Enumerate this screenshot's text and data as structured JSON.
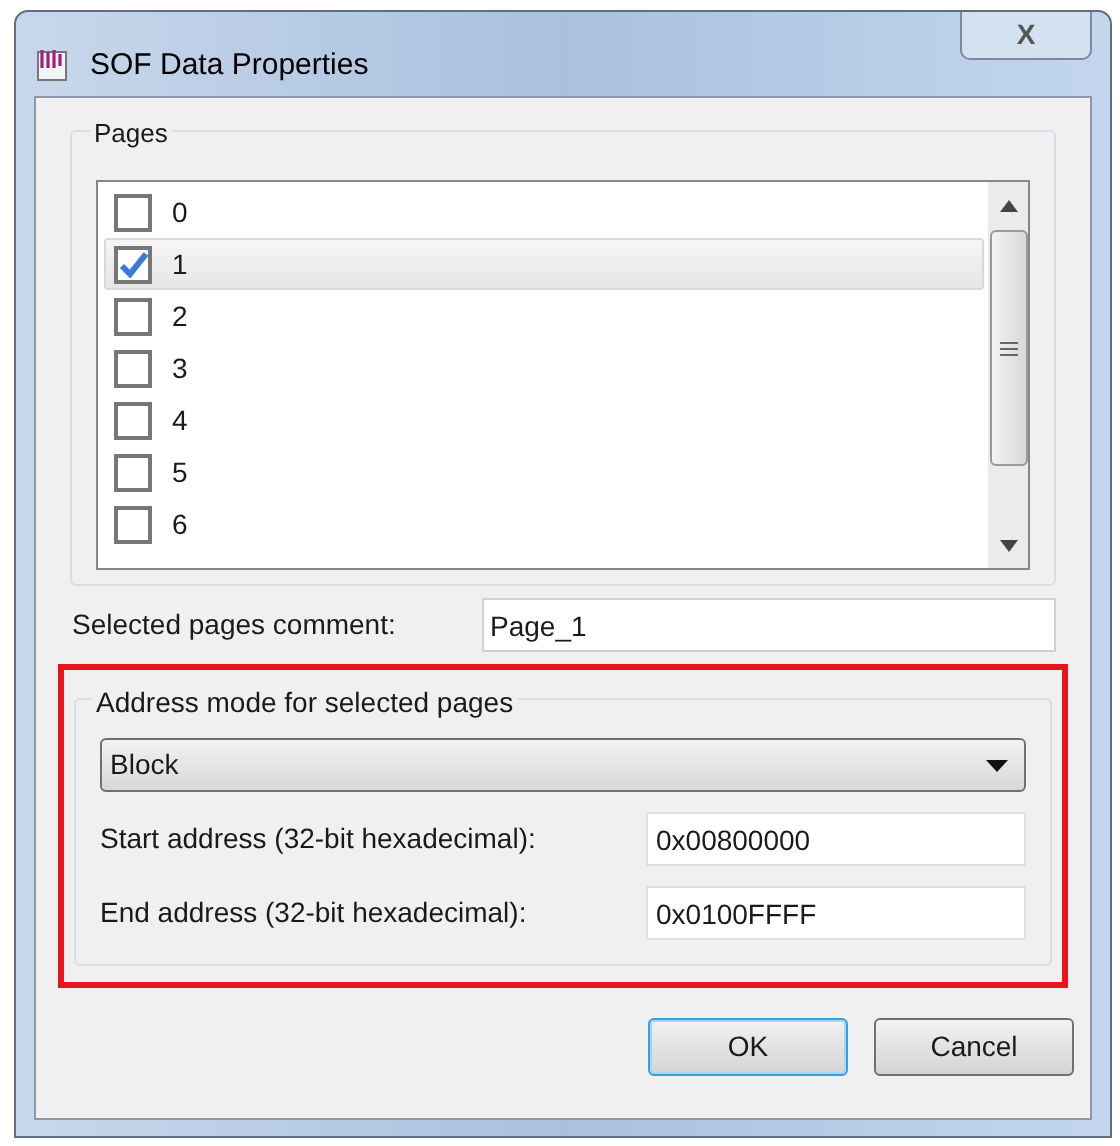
{
  "window": {
    "title": "SOF Data Properties",
    "close": "X"
  },
  "pages": {
    "label": "Pages",
    "items": [
      {
        "label": "0",
        "checked": false,
        "selected": false
      },
      {
        "label": "1",
        "checked": true,
        "selected": true
      },
      {
        "label": "2",
        "checked": false,
        "selected": false
      },
      {
        "label": "3",
        "checked": false,
        "selected": false
      },
      {
        "label": "4",
        "checked": false,
        "selected": false
      },
      {
        "label": "5",
        "checked": false,
        "selected": false
      },
      {
        "label": "6",
        "checked": false,
        "selected": false
      }
    ]
  },
  "comment": {
    "label": "Selected pages comment:",
    "value": "Page_1"
  },
  "address_mode": {
    "label": "Address mode for selected pages",
    "mode": "Block",
    "fields": [
      {
        "label": "Start address (32-bit hexadecimal):",
        "value": "0x00800000"
      },
      {
        "label": "End address (32-bit hexadecimal):",
        "value": "0x0100FFFF"
      }
    ]
  },
  "buttons": [
    {
      "label": "OK",
      "default": true
    },
    {
      "label": "Cancel",
      "default": false
    }
  ]
}
